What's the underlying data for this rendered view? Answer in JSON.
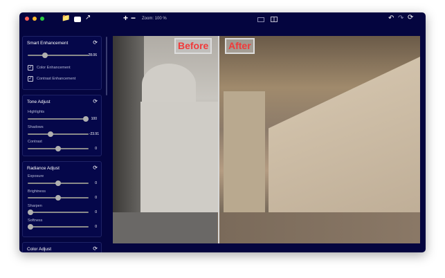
{
  "toolbar": {
    "zoom_label": "Zoom: 100 %"
  },
  "panels": {
    "smart": {
      "title": "Smart Enhancement",
      "slider": {
        "value": "28.06",
        "fraction": 0.28
      },
      "checks": [
        {
          "label": "Color Enhancement",
          "checked": true
        },
        {
          "label": "Contrast Enhancement",
          "checked": true
        }
      ]
    },
    "tone": {
      "title": "Tone Adjust",
      "sliders": [
        {
          "label": "Highlights",
          "value": "100",
          "fraction": 1.0
        },
        {
          "label": "Shadows",
          "value": "-23.91",
          "fraction": 0.38
        },
        {
          "label": "Contrast",
          "value": "0",
          "fraction": 0.5
        }
      ]
    },
    "radiance": {
      "title": "Radiance Adjust",
      "sliders": [
        {
          "label": "Exposure",
          "value": "0",
          "fraction": 0.5
        },
        {
          "label": "Brightness",
          "value": "0",
          "fraction": 0.5
        },
        {
          "label": "Sharpen",
          "value": "0",
          "fraction": 0
        },
        {
          "label": "Softness",
          "value": "0",
          "fraction": 0
        }
      ]
    },
    "color": {
      "title": "Color Adjust"
    }
  },
  "photo": {
    "before_label": "Before",
    "after_label": "After"
  },
  "colors": {
    "bg": "#04053f",
    "accent_red": "#f13a3a"
  }
}
